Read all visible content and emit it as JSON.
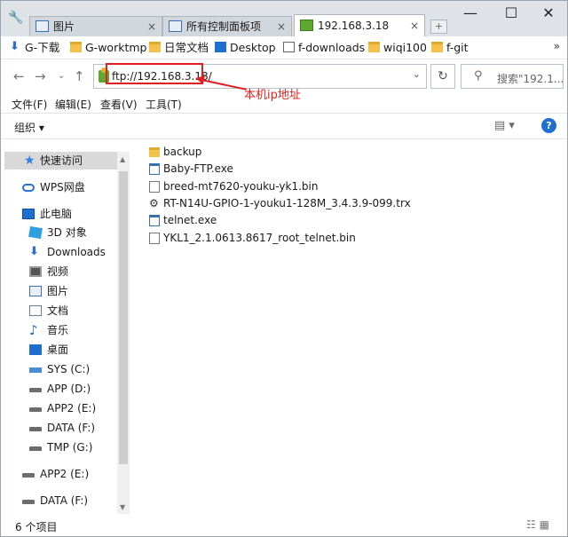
{
  "tabs": [
    {
      "label": "图片",
      "close": "×"
    },
    {
      "label": "所有控制面板项",
      "close": "×"
    },
    {
      "label": "192.168.3.18",
      "close": "×"
    }
  ],
  "window_controls": {
    "minimize": "—",
    "maximize": "☐",
    "close": "✕"
  },
  "bookmarks": [
    {
      "label": "G-下载",
      "icon": "download-icon"
    },
    {
      "label": "G-worktmp",
      "icon": "folder-icon"
    },
    {
      "label": "日常文档",
      "icon": "folder-icon"
    },
    {
      "label": "Desktop",
      "icon": "desktop-icon"
    },
    {
      "label": "f-downloads",
      "icon": "file-icon"
    },
    {
      "label": "wiqi100",
      "icon": "folder-icon"
    },
    {
      "label": "f-git",
      "icon": "folder-icon"
    }
  ],
  "bookmarks_more": "»",
  "address": {
    "value": "ftp://192.168.3.18/"
  },
  "search": {
    "placeholder": "搜索\"192.1..."
  },
  "annotation": {
    "text": "本机ip地址",
    "color": "#e02020"
  },
  "menus": [
    "文件(F)",
    "编辑(E)",
    "查看(V)",
    "工具(T)"
  ],
  "toolbar": {
    "organize": "组织 ▾",
    "help": "?"
  },
  "sidebar": {
    "items": [
      {
        "label": "快速访问",
        "icon": "star-icon"
      },
      {
        "label": "WPS网盘",
        "icon": "cloud-icon"
      },
      {
        "label": "此电脑",
        "icon": "computer-icon"
      },
      {
        "label": "3D 对象",
        "icon": "cube-icon"
      },
      {
        "label": "Downloads",
        "icon": "download-icon"
      },
      {
        "label": "视频",
        "icon": "video-icon"
      },
      {
        "label": "图片",
        "icon": "pictures-icon"
      },
      {
        "label": "文档",
        "icon": "document-icon"
      },
      {
        "label": "音乐",
        "icon": "music-icon"
      },
      {
        "label": "桌面",
        "icon": "desktop-icon"
      },
      {
        "label": "SYS (C:)",
        "icon": "system-drive-icon"
      },
      {
        "label": "APP (D:)",
        "icon": "drive-icon"
      },
      {
        "label": "APP2 (E:)",
        "icon": "drive-icon"
      },
      {
        "label": "DATA (F:)",
        "icon": "drive-icon"
      },
      {
        "label": "TMP (G:)",
        "icon": "drive-icon"
      },
      {
        "label": "APP2 (E:)",
        "icon": "drive-icon"
      },
      {
        "label": "DATA (F:)",
        "icon": "drive-icon"
      }
    ]
  },
  "files": [
    {
      "name": "backup",
      "icon": "folder-icon"
    },
    {
      "name": "Baby-FTP.exe",
      "icon": "exe-icon"
    },
    {
      "name": "breed-mt7620-youku-yk1.bin",
      "icon": "file-icon"
    },
    {
      "name": "RT-N14U-GPIO-1-youku1-128M_3.4.3.9-099.trx",
      "icon": "trx-icon"
    },
    {
      "name": "telnet.exe",
      "icon": "exe-icon"
    },
    {
      "name": "YKL1_2.1.0613.8617_root_telnet.bin",
      "icon": "file-icon"
    }
  ],
  "status": {
    "count": "6 个项目"
  }
}
